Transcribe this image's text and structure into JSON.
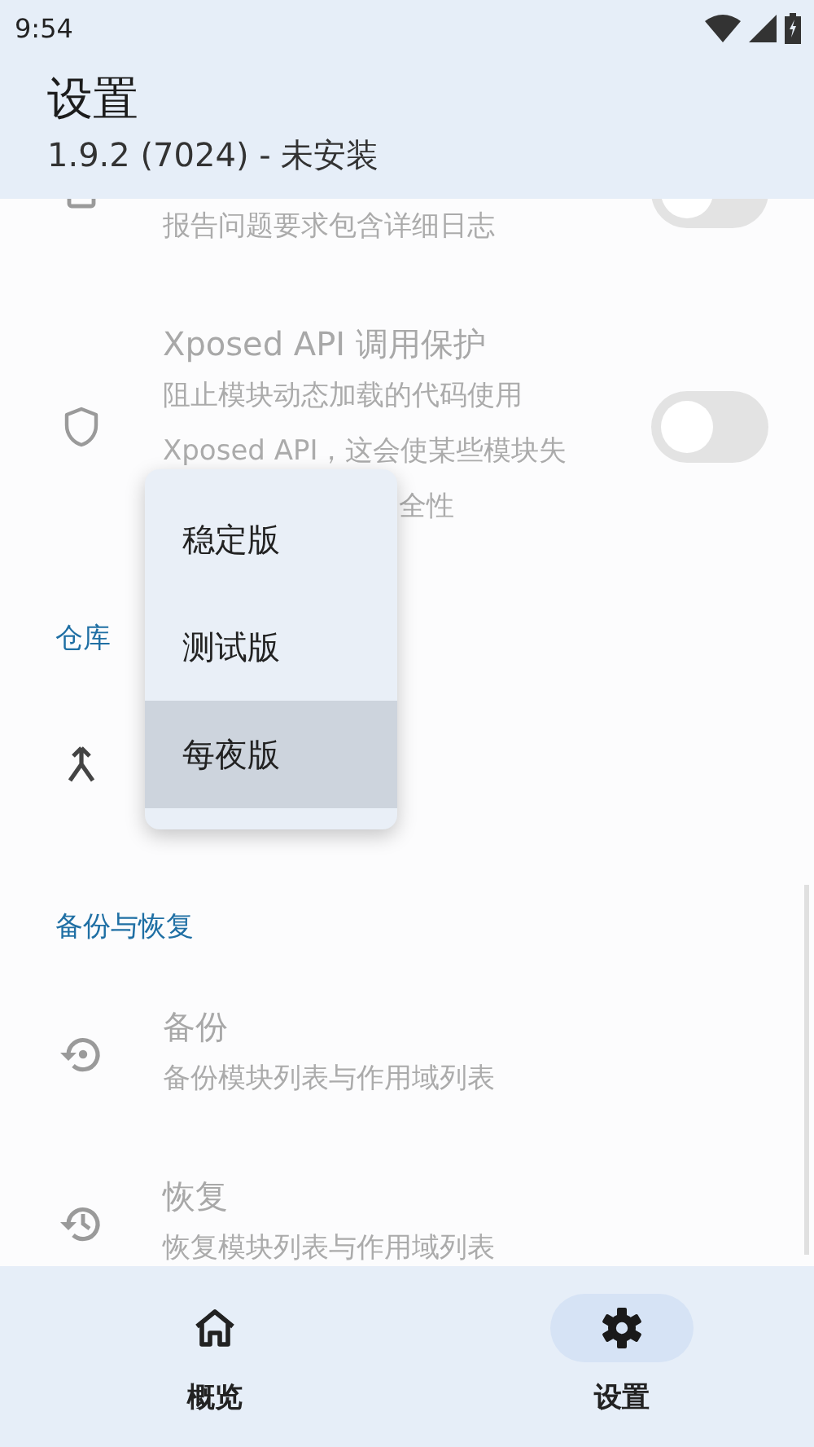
{
  "status_bar": {
    "time": "9:54"
  },
  "app_bar": {
    "title": "设置",
    "subtitle": "1.9.2 (7024) - 未安装"
  },
  "sections": [
    {
      "items": [
        {
          "kind": "switch",
          "summary": [
            "报告问题要求包含详细日志"
          ],
          "on": false,
          "disabled": true
        },
        {
          "kind": "switch",
          "title": "Xposed API 调用保护",
          "summary": [
            "阻止模块动态加载的代码使用",
            "Xposed API，这会使某些模块失",
            "全性"
          ],
          "on": false,
          "disabled": true
        }
      ]
    },
    {
      "title": "仓库",
      "items": [
        {
          "kind": "choice",
          "disabled": false
        }
      ]
    },
    {
      "title": "备份与恢复",
      "items": [
        {
          "kind": "action",
          "title": "备份",
          "summary": [
            "备份模块列表与作用域列表"
          ],
          "disabled": true
        },
        {
          "kind": "action",
          "title": "恢复",
          "summary": [
            "恢复模块列表与作用域列表"
          ],
          "disabled": true
        }
      ]
    }
  ],
  "menu": {
    "items": [
      {
        "label": "稳定版",
        "selected": false
      },
      {
        "label": "测试版",
        "selected": false
      },
      {
        "label": "每夜版",
        "selected": true
      }
    ]
  },
  "nav": [
    {
      "label": "概览",
      "selected": false
    },
    {
      "label": "设置",
      "selected": true
    }
  ]
}
